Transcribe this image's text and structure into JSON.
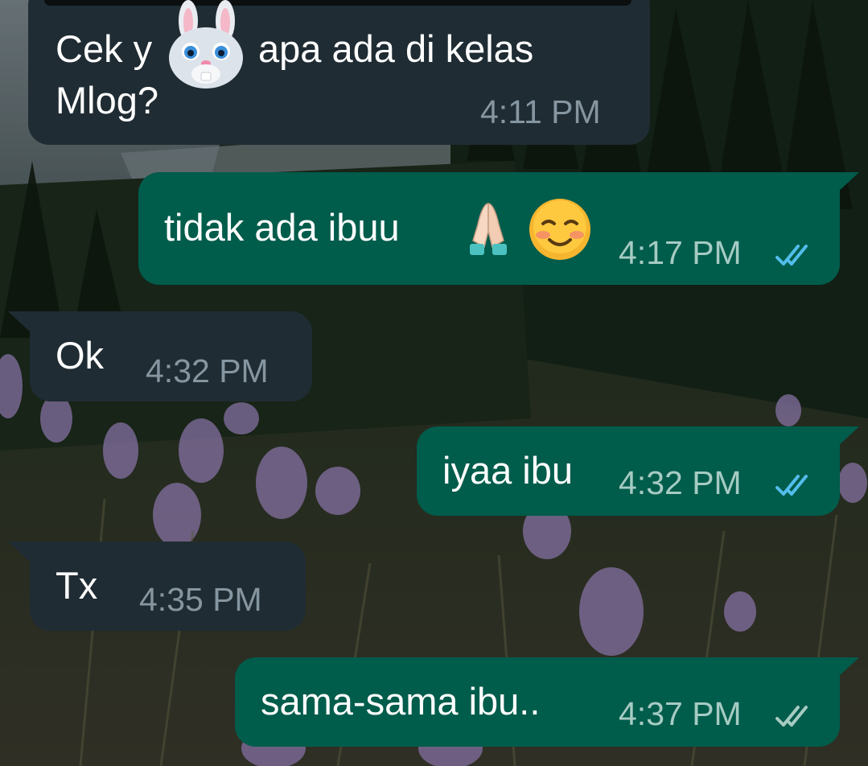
{
  "chat": {
    "messages": [
      {
        "direction": "incoming",
        "text_line1": "Cek y",
        "text_line1b": "apa ada di kelas",
        "text_line2": "Mlog?",
        "time": "4:11 PM",
        "sticker": "bunny-face-emoji"
      },
      {
        "direction": "outgoing",
        "text": "tidak ada ibuu",
        "emojis": [
          "folded-hands-emoji",
          "smiling-blush-face-emoji"
        ],
        "time": "4:17 PM",
        "status": "read",
        "status_icon": "double-check-icon",
        "status_color": "#53bdeb"
      },
      {
        "direction": "incoming",
        "text": "Ok",
        "time": "4:32 PM"
      },
      {
        "direction": "outgoing",
        "text": "iyaa ibu",
        "time": "4:32 PM",
        "status": "read",
        "status_icon": "double-check-icon",
        "status_color": "#53bdeb"
      },
      {
        "direction": "incoming",
        "text": "Tx",
        "time": "4:35 PM"
      },
      {
        "direction": "outgoing",
        "text": "sama-sama ibu..",
        "time": "4:37 PM",
        "status": "delivered",
        "status_icon": "double-check-icon",
        "status_color": "#a6cbc3"
      }
    ]
  },
  "colors": {
    "incoming_bubble": "#202c33",
    "outgoing_bubble": "#005c4b",
    "read_tick": "#53bdeb",
    "time_incoming": "#8696a0",
    "time_outgoing": "#a6cbc3"
  },
  "wallpaper": "forest-meadow-with-purple-flowers"
}
